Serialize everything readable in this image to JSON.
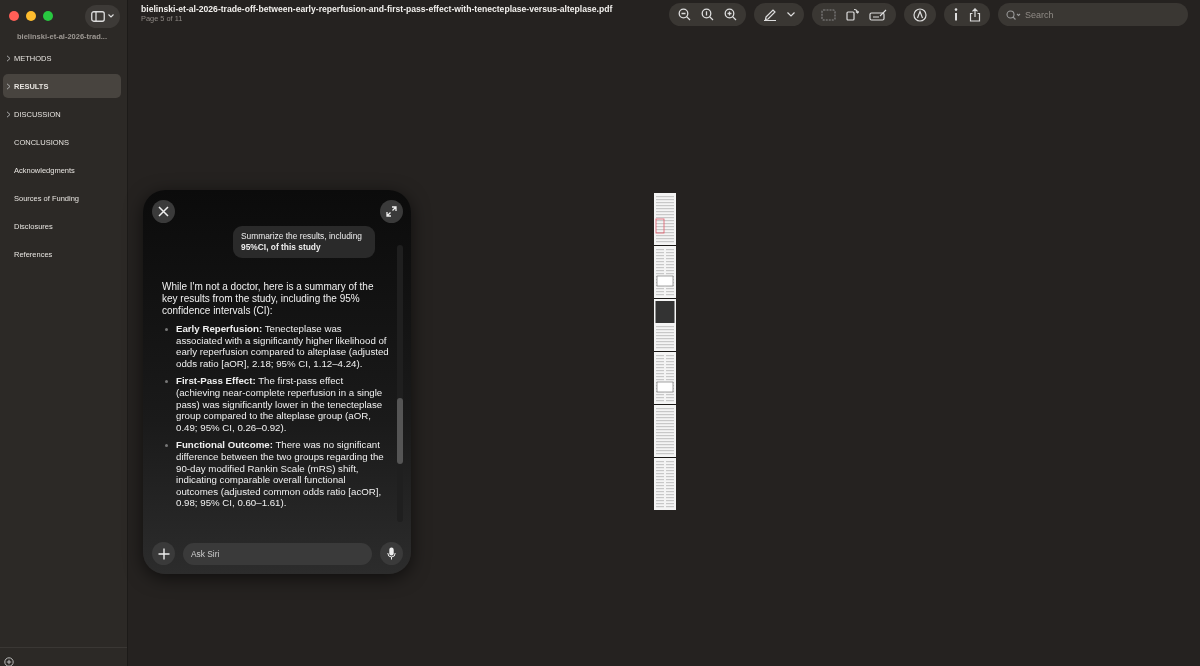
{
  "window": {
    "title": "bielinski-et-al-2026-trade-off-between-early-reperfusion-and-first-pass-effect-with-tenecteplase-versus-alteplase.pdf",
    "subtitle": "Page 5 of 11"
  },
  "sidebar": {
    "document": "bielinski-et-al-2026-trad...",
    "items": [
      {
        "label": "METHODS",
        "kind": "group",
        "selected": false
      },
      {
        "label": "RESULTS",
        "kind": "group",
        "selected": true
      },
      {
        "label": "DISCUSSION",
        "kind": "group",
        "selected": false
      },
      {
        "label": "CONCLUSIONS",
        "kind": "leaf",
        "selected": false
      },
      {
        "label": "Acknowledgments",
        "kind": "leaf",
        "selected": false
      },
      {
        "label": "Sources of Funding",
        "kind": "leaf",
        "selected": false
      },
      {
        "label": "Disclosures",
        "kind": "leaf",
        "selected": false
      },
      {
        "label": "References",
        "kind": "leaf",
        "selected": false
      }
    ]
  },
  "search": {
    "placeholder": "Search"
  },
  "siri": {
    "prompt": "Summarize the results, including **95%CI, of this study**",
    "intro": "While I'm not a doctor, here is a summary of the key results from the study, including the 95% confidence intervals (CI):",
    "bullets": [
      "**Early Reperfusion:** Tenecteplase was associated with a significantly higher likelihood of early reperfusion compared to alteplase (adjusted odds ratio [aOR], 2.18; 95% CI, 1.12–4.24).",
      "**First-Pass Effect:** The first-pass effect (achieving near-complete reperfusion in a single pass) was significantly lower in the tenecteplase group compared to the alteplase group (aOR, 0.49; 95% CI, 0.26–0.92).",
      "**Functional Outcome:** There was no significant difference between the two groups regarding the 90-day modified Rankin Scale (mRS) shift, indicating comparable overall functional outcomes (adjusted common odds ratio [acOR], 0.98; 95% CI, 0.60–1.61)."
    ],
    "input_placeholder": "Ask Siri"
  }
}
